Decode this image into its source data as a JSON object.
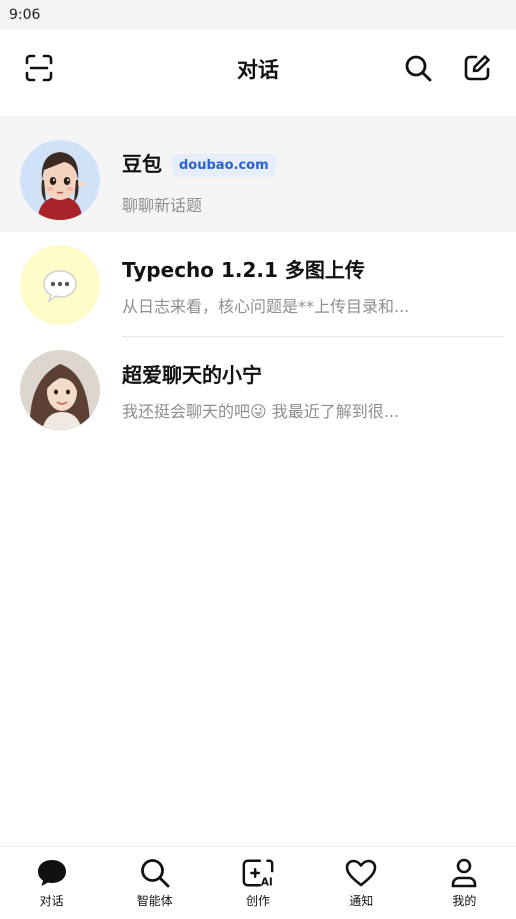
{
  "status_bar": {
    "time": "9:06"
  },
  "header": {
    "title": "对话",
    "scan_icon": "scan-icon",
    "search_icon": "search-icon",
    "compose_icon": "compose-icon"
  },
  "chats": [
    {
      "name": "豆包",
      "badge": "doubao.com",
      "preview": "聊聊新话题",
      "avatar": "doubao-avatar"
    },
    {
      "name": "Typecho 1.2.1 多图上传",
      "preview": "从日志来看，核心问题是**上传目录和...",
      "avatar": "chat-bubble-avatar"
    },
    {
      "name": "超爱聊天的小宁",
      "preview": "我还挺会聊天的吧😜 我最近了解到很...",
      "avatar": "girl-avatar"
    }
  ],
  "bottom_nav": [
    {
      "label": "对话",
      "icon": "chat-icon"
    },
    {
      "label": "智能体",
      "icon": "search-icon"
    },
    {
      "label": "创作",
      "icon": "create-ai-icon"
    },
    {
      "label": "通知",
      "icon": "heart-icon"
    },
    {
      "label": "我的",
      "icon": "profile-icon"
    }
  ],
  "colors": {
    "badge_bg": "#e6eefb",
    "badge_text": "#2a62d6",
    "active_row": "#f5f5f5",
    "preview_text": "#8e8e8e"
  }
}
